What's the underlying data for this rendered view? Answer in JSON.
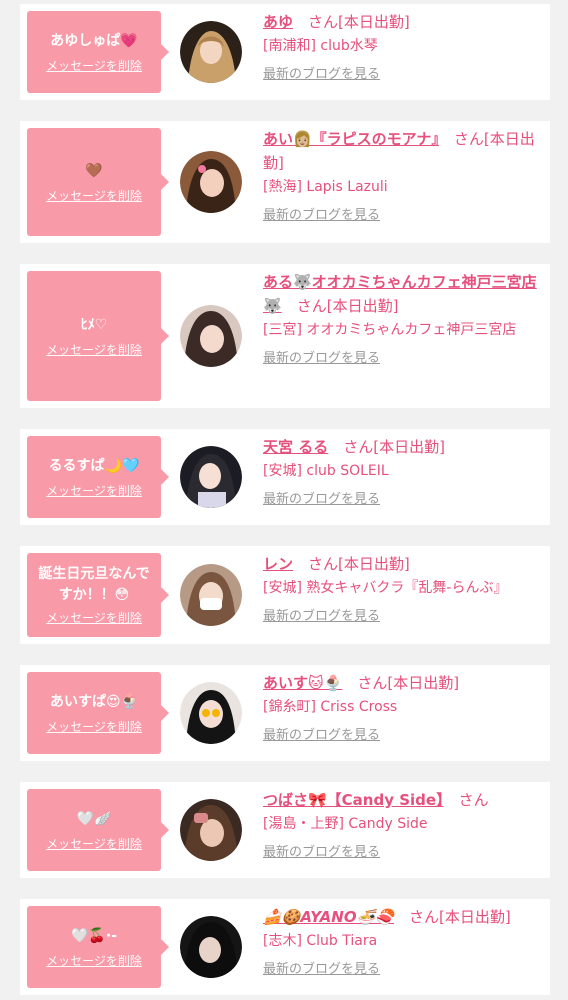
{
  "colors": {
    "accent": "#e6507c",
    "bubble": "#f99aa8",
    "background": "#f1f1f1",
    "card": "#ffffff"
  },
  "common": {
    "delete_label": "メッセージを削除",
    "blog_label": "最新のブログを見る",
    "san": "さん"
  },
  "items": [
    {
      "message": "あゆしゅぱ💗",
      "name": "あゆ",
      "status": "[本日出勤]",
      "area": "[南浦和]",
      "shop": "club水琴"
    },
    {
      "message": "🤎",
      "name": "あい👩🏼『ラピスのモアナ』",
      "status": "[本日出勤]",
      "area": "[熱海]",
      "shop": "Lapis Lazuli"
    },
    {
      "message": "ﾋﾒ♡",
      "name": "ある🐺オオカミちゃんカフェ神戸三宮店🐺",
      "status": "[本日出勤]",
      "area": "[三宮]",
      "shop": "オオカミちゃんカフェ神戸三宮店"
    },
    {
      "message": "るるすぱ🌙🩵",
      "name": "天宮 るる",
      "status": "[本日出勤]",
      "area": "[安城]",
      "shop": "club SOLEIL"
    },
    {
      "message": "誕生日元旦なんですか！！😳",
      "name": "レン",
      "status": "[本日出勤]",
      "area": "[安城]",
      "shop": "熟女キャバクラ『乱舞-らんぶ』"
    },
    {
      "message": "あいすぱ😍🍨",
      "name": "あいす🐱🍨",
      "status": "[本日出勤]",
      "area": "[錦糸町]",
      "shop": "Criss Cross"
    },
    {
      "message": "🤍🪽",
      "name": "つばさ🎀【Candy Side】",
      "status": "",
      "area": "[湯島・上野]",
      "shop": "Candy Side"
    },
    {
      "message": "🤍🍒·-",
      "name": "🍰🍪AYANO🍜🍣",
      "status": "[本日出勤]",
      "area": "[志木]",
      "shop": "Club Tiara"
    }
  ]
}
